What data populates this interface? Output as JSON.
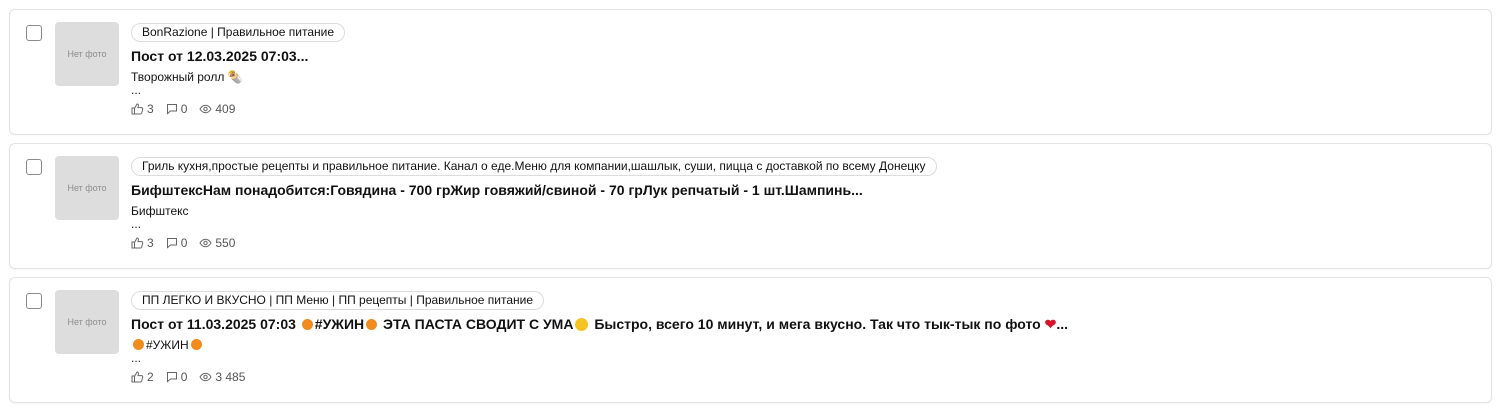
{
  "placeholder_thumb": "Нет фото",
  "posts": [
    {
      "channel": "BonRazione | Правильное питание",
      "title": "Пост от 12.03.2025 07:03...",
      "excerpt": "Творожный ролл 🌯",
      "ellipsis": "...",
      "likes": "3",
      "comments": "0",
      "views": "409"
    },
    {
      "channel": "Гриль кухня,простые рецепты и правильное питание. Канал о еде.Меню для компании,шашлык, суши, пицца с доставкой по всему Донецку",
      "title": "БифштексНам понадобится:Говядина - 700 грЖир говяжий/свиной - 70 грЛук репчатый - 1 шт.Шампинь...",
      "excerpt": "Бифштекс",
      "ellipsis": "...",
      "likes": "3",
      "comments": "0",
      "views": "550"
    },
    {
      "channel": "ПП ЛЕГКО И ВКУСНО | ПП Меню | ПП рецепты | Правильное питание",
      "title_parts": {
        "a": "Пост от 11.03.2025 07:03",
        "b": "#УЖИН",
        "c": "ЭТА ПАСТА СВОДИТ С УМА",
        "d": "Быстро, всего 10 минут, и мега вкусно. Так что тык-тык по фото",
        "e": "..."
      },
      "excerpt": "#УЖИН",
      "ellipsis": "...",
      "likes": "2",
      "comments": "0",
      "views": "3 485"
    }
  ],
  "icons": {
    "like": "thumbs-up-icon",
    "comment": "comment-icon",
    "view": "eye-icon"
  },
  "colors": {
    "border": "#e3e3e3",
    "thumb_bg": "#dddddd",
    "stat_text": "#555555"
  }
}
